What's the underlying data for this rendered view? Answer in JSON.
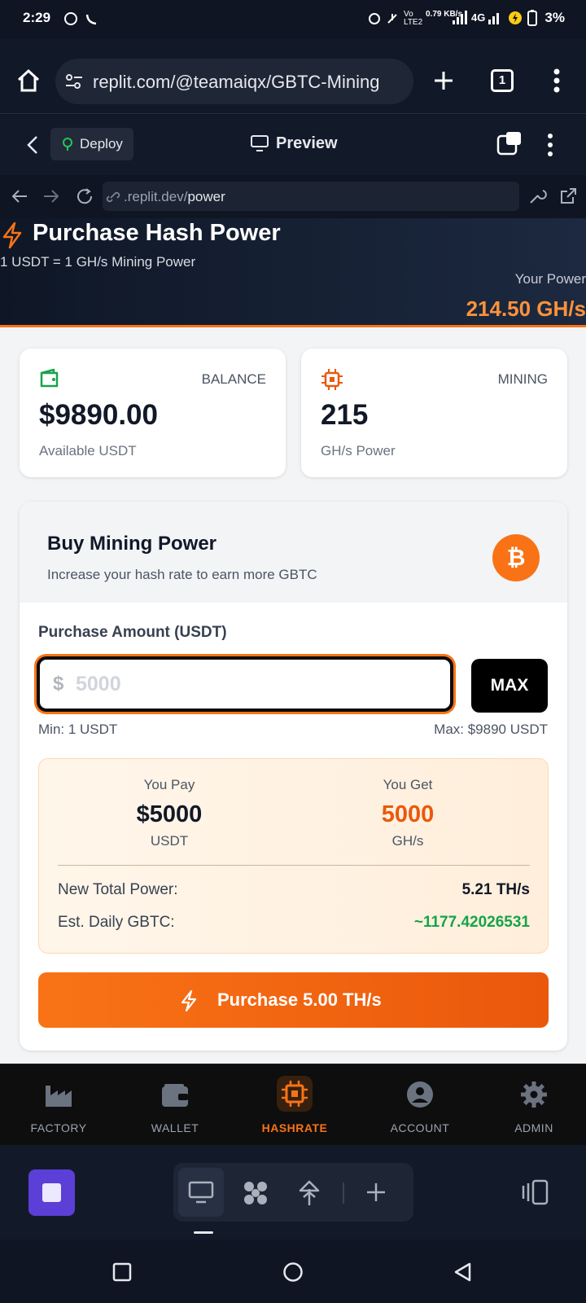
{
  "status_bar": {
    "time": "2:29",
    "battery": "3%",
    "network": "4G",
    "speed": "0.79 KB/s"
  },
  "browser": {
    "url": "replit.com/@teamaiqx/GBTC-Mining",
    "tab_count": "1"
  },
  "replit": {
    "deploy_label": "Deploy",
    "preview_label": "Preview",
    "address_domain": ".replit.dev/",
    "address_path": "power"
  },
  "hero": {
    "title": "Purchase Hash Power",
    "subtitle": "1 USDT = 1 GH/s Mining Power",
    "power_label": "Your Power",
    "power_value": "214.50 GH/s"
  },
  "stats": {
    "balance": {
      "label": "BALANCE",
      "value": "$9890.00",
      "sub": "Available USDT"
    },
    "mining": {
      "label": "MINING",
      "value": "215",
      "sub": "GH/s Power"
    }
  },
  "buy": {
    "title": "Buy Mining Power",
    "subtitle": "Increase your hash rate to earn more GBTC",
    "badge": "₿",
    "amount_label": "Purchase Amount (USDT)",
    "currency_symbol": "$",
    "amount_value": "5000",
    "max_label": "MAX",
    "min_text": "Min: 1 USDT",
    "max_text": "Max: $9890 USDT",
    "pay": {
      "label": "You Pay",
      "value": "$5000",
      "unit": "USDT"
    },
    "get": {
      "label": "You Get",
      "value": "5000",
      "unit": "GH/s"
    },
    "new_total_label": "New Total Power:",
    "new_total_value": "5.21 TH/s",
    "daily_label": "Est. Daily GBTC:",
    "daily_value": "~1177.42026531",
    "purchase_label": "Purchase 5.00 TH/s"
  },
  "nav": {
    "items": [
      {
        "label": "FACTORY",
        "icon": "factory-icon",
        "active": false
      },
      {
        "label": "WALLET",
        "icon": "wallet-icon",
        "active": false
      },
      {
        "label": "HASHRATE",
        "icon": "chip-icon",
        "active": true
      },
      {
        "label": "ACCOUNT",
        "icon": "user-circle-icon",
        "active": false
      },
      {
        "label": "ADMIN",
        "icon": "gear-icon",
        "active": false
      }
    ]
  },
  "colors": {
    "accent": "#f97316",
    "green": "#16a34a",
    "dark": "#111827"
  }
}
